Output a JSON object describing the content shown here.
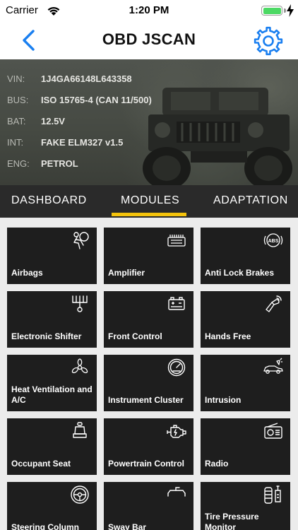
{
  "status_bar": {
    "carrier": "Carrier",
    "time": "1:20 PM",
    "battery_level": 1.0
  },
  "nav": {
    "title": "OBD JSCAN"
  },
  "vehicle": {
    "rows": [
      {
        "key": "VIN:",
        "value": "1J4GA66148L643358"
      },
      {
        "key": "BUS:",
        "value": "ISO 15765-4 (CAN 11/500)"
      },
      {
        "key": "BAT:",
        "value": "12.5V"
      },
      {
        "key": "INT:",
        "value": "FAKE ELM327 v1.5"
      },
      {
        "key": "ENG:",
        "value": "PETROL"
      }
    ]
  },
  "tabs": [
    {
      "label": "DASHBOARD",
      "active": false
    },
    {
      "label": "MODULES",
      "active": true
    },
    {
      "label": "ADAPTATION",
      "active": false
    }
  ],
  "modules": [
    {
      "label": "Airbags",
      "icon": "airbag-icon"
    },
    {
      "label": "Amplifier",
      "icon": "amplifier-icon"
    },
    {
      "label": "Anti Lock Brakes",
      "icon": "abs-icon"
    },
    {
      "label": "Electronic Shifter",
      "icon": "gear-shifter-icon"
    },
    {
      "label": "Front Control",
      "icon": "car-battery-icon"
    },
    {
      "label": "Hands Free",
      "icon": "hands-free-icon"
    },
    {
      "label": "Heat Ventilation and A/C",
      "icon": "fan-icon"
    },
    {
      "label": "Instrument Cluster",
      "icon": "gauge-icon"
    },
    {
      "label": "Intrusion",
      "icon": "car-alarm-icon"
    },
    {
      "label": "Occupant Seat",
      "icon": "seat-icon"
    },
    {
      "label": "Powertrain Control",
      "icon": "engine-icon"
    },
    {
      "label": "Radio",
      "icon": "radio-icon"
    },
    {
      "label": "Steering Column",
      "icon": "steering-wheel-icon"
    },
    {
      "label": "Sway Bar",
      "icon": "sway-bar-icon"
    },
    {
      "label": "Tire Pressure Monitor",
      "icon": "tire-pressure-icon"
    }
  ],
  "colors": {
    "accent": "#f4c30c",
    "nav_blue": "#1a7ff0",
    "tile": "#1e1e1e",
    "tab_bar": "#2a2a2a"
  }
}
